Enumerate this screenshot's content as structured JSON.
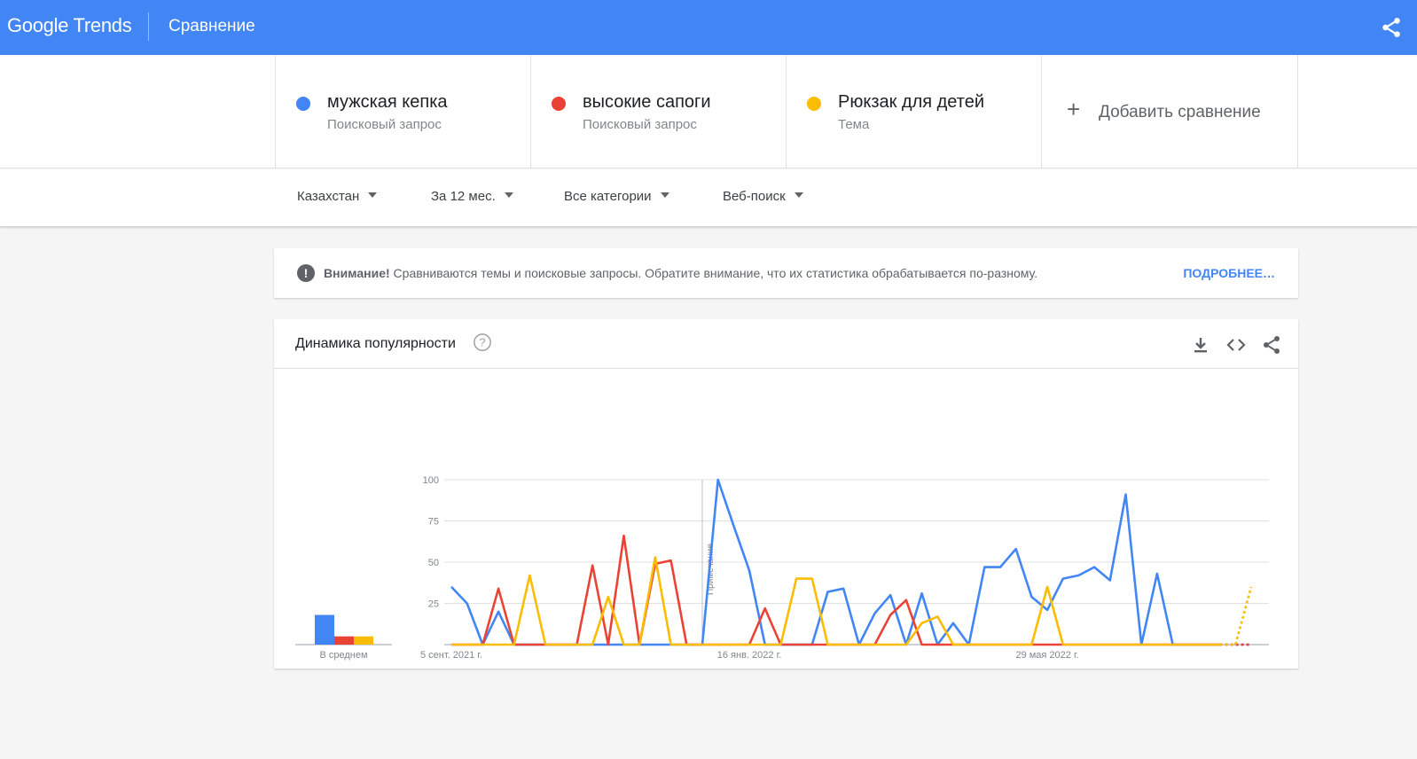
{
  "header": {
    "logo_text": "Google Trends",
    "page_title": "Сравнение",
    "share_icon": "share-icon",
    "background_color": "#4285f4"
  },
  "terms": [
    {
      "name": "мужская кепка",
      "type": "Поисковый запрос",
      "color": "#4285f4"
    },
    {
      "name": "высокие сапоги",
      "type": "Поисковый запрос",
      "color": "#ea4335"
    },
    {
      "name": "Рюкзак для детей",
      "type": "Тема",
      "color": "#fbbc04"
    }
  ],
  "add_comparison": {
    "plus": "+",
    "label": "Добавить сравнение"
  },
  "filters": {
    "region": "Казахстан",
    "period": "За 12 мес.",
    "category": "Все категории",
    "search_type": "Веб-поиск"
  },
  "notice": {
    "icon": "!",
    "bold": "Внимание!",
    "text": " Сравниваются темы и поисковые запросы. Обратите внимание, что их статистика обрабатывается по-разному.",
    "link": "ПОДРОБНЕЕ…"
  },
  "chart_card": {
    "title": "Динамика популярности",
    "help_icon": "help-circle-icon",
    "tools": [
      "download-icon",
      "embed-code-icon",
      "share-icon"
    ]
  },
  "chart_data": {
    "type": "line",
    "ylim": [
      0,
      100
    ],
    "yticks": [
      "100",
      "75",
      "50",
      "25"
    ],
    "xtick_labels": [
      {
        "label": "5 сент. 2021 г.",
        "index": 0
      },
      {
        "label": "16 янв. 2022 г.",
        "index": 19
      },
      {
        "label": "29 мая 2022 г.",
        "index": 38
      }
    ],
    "annotation": {
      "label": "Примечание",
      "index": 16
    },
    "average": {
      "label": "В среднем",
      "values": [
        18,
        5,
        5
      ]
    },
    "partial_from_index": 49,
    "series": [
      {
        "name": "мужская кепка",
        "color": "#4285f4",
        "values": [
          35,
          25,
          0,
          20,
          0,
          0,
          0,
          0,
          0,
          0,
          0,
          0,
          0,
          0,
          0,
          0,
          0,
          100,
          72,
          45,
          0,
          0,
          0,
          0,
          32,
          34,
          0,
          19,
          30,
          0,
          31,
          0,
          13,
          0,
          47,
          47,
          58,
          29,
          21,
          40,
          42,
          47,
          39,
          91,
          0,
          43,
          0,
          0,
          0,
          0,
          0,
          0
        ]
      },
      {
        "name": "высокие сапоги",
        "color": "#ea4335",
        "values": [
          0,
          0,
          0,
          34,
          0,
          0,
          0,
          0,
          0,
          48,
          0,
          66,
          0,
          49,
          51,
          0,
          0,
          0,
          0,
          0,
          22,
          0,
          0,
          0,
          0,
          0,
          0,
          0,
          18,
          27,
          0,
          0,
          0,
          0,
          0,
          0,
          0,
          0,
          0,
          0,
          0,
          0,
          0,
          0,
          0,
          0,
          0,
          0,
          0,
          0,
          0,
          0
        ]
      },
      {
        "name": "Рюкзак для детей",
        "color": "#fbbc04",
        "values": [
          0,
          0,
          0,
          0,
          0,
          42,
          0,
          0,
          0,
          0,
          29,
          0,
          0,
          53,
          0,
          0,
          0,
          0,
          0,
          0,
          0,
          0,
          40,
          40,
          0,
          0,
          0,
          0,
          0,
          0,
          13,
          17,
          0,
          0,
          0,
          0,
          0,
          0,
          35,
          0,
          0,
          0,
          0,
          0,
          0,
          0,
          0,
          0,
          0,
          0,
          0,
          35
        ]
      }
    ]
  }
}
